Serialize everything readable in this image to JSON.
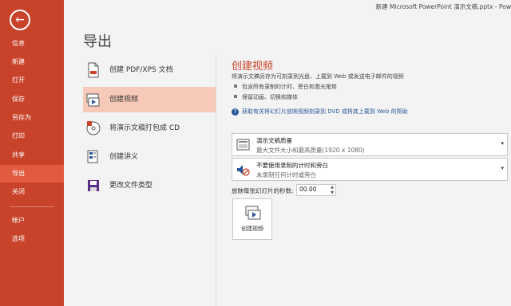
{
  "window_title": "新建 Microsoft PowerPoint 演示文稿.pptx - Pow",
  "back_icon": "arrow-left-icon",
  "colors": {
    "sidebar": "#c9432a",
    "sidebar_active": "#e35b3f",
    "accent": "#c9432a",
    "selected_option": "#f7c9b8",
    "link": "#2b579a"
  },
  "sidebar": {
    "items": [
      {
        "label": "信息"
      },
      {
        "label": "新建"
      },
      {
        "label": "打开"
      },
      {
        "label": "保存"
      },
      {
        "label": "另存为"
      },
      {
        "label": "打印"
      },
      {
        "label": "共享"
      },
      {
        "label": "导出",
        "active": true
      },
      {
        "label": "关闭"
      },
      {
        "label": "帐户"
      },
      {
        "label": "选项"
      }
    ]
  },
  "page_title": "导出",
  "options": [
    {
      "label": "创建 PDF/XPS 文档",
      "icon": "pdf-document-icon"
    },
    {
      "label": "创建视频",
      "icon": "video-icon",
      "active": true
    },
    {
      "label": "将演示文稿打包成 CD",
      "icon": "cd-icon"
    },
    {
      "label": "创建讲义",
      "icon": "handout-icon"
    },
    {
      "label": "更改文件类型",
      "icon": "save-file-icon"
    }
  ],
  "detail": {
    "title": "创建视频",
    "description": "将演示文稿另存为可刻录到光盘、上载到 Web 或发送电子邮件的视频",
    "bullets": [
      "包含所有录制的计时、旁白和激光笔势",
      "保留动画、切换和媒体"
    ],
    "help_link": "获取有关将幻灯片放映视频刻录到 DVD 或将其上载到 Web 的帮助",
    "quality": {
      "title": "演示文稿质量",
      "subtitle": "最大文件大小和最高质量(1920 x 1080)"
    },
    "timings": {
      "title": "不要使用录制的计时和旁白",
      "subtitle": "未录制任何计时或旁白"
    },
    "seconds_label": "放映每张幻灯片的秒数:",
    "seconds_value": "00.00",
    "create_button": "创建视频"
  }
}
